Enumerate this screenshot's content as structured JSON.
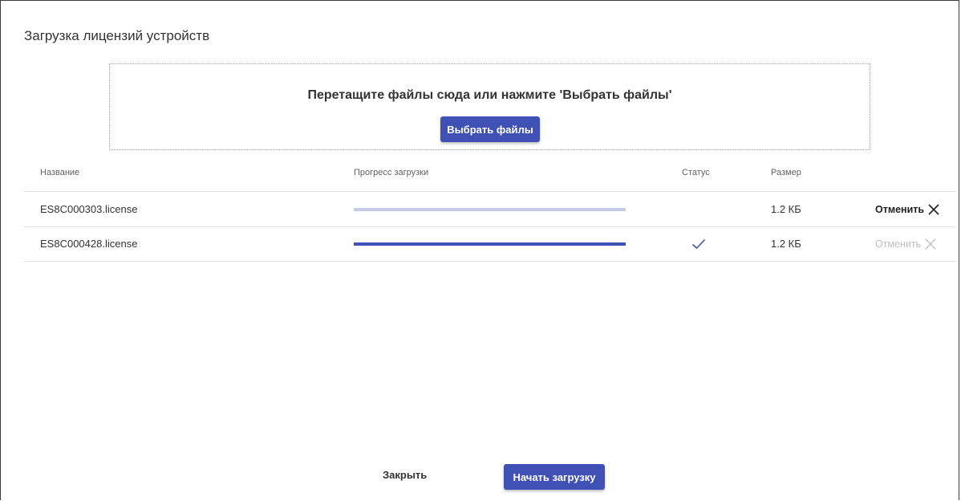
{
  "dialog": {
    "title": "Загрузка лицензий устройств"
  },
  "dropzone": {
    "text": "Перетащите файлы сюда или нажмите 'Выбрать файлы'",
    "button_label": "Выбрать файлы"
  },
  "table": {
    "columns": [
      "Название",
      "Прогресс загрузки",
      "Статус",
      "Размер"
    ],
    "rows": [
      {
        "name": "ES8C000303.license",
        "progress": 0,
        "status": "",
        "size": "1.2 КБ",
        "action_label": "Отменить",
        "action_enabled": true
      },
      {
        "name": "ES8C000428.license",
        "progress": 100,
        "status": "done-check-icon",
        "size": "1.2 КБ",
        "action_label": "Отменить",
        "action_enabled": false
      }
    ]
  },
  "footer": {
    "close_label": "Закрыть",
    "start_label": "Начать загрузку"
  },
  "colors": {
    "accent": "#3f51b5",
    "progress_track": "#c5cae9",
    "disabled_text": "#bdbdbd"
  }
}
